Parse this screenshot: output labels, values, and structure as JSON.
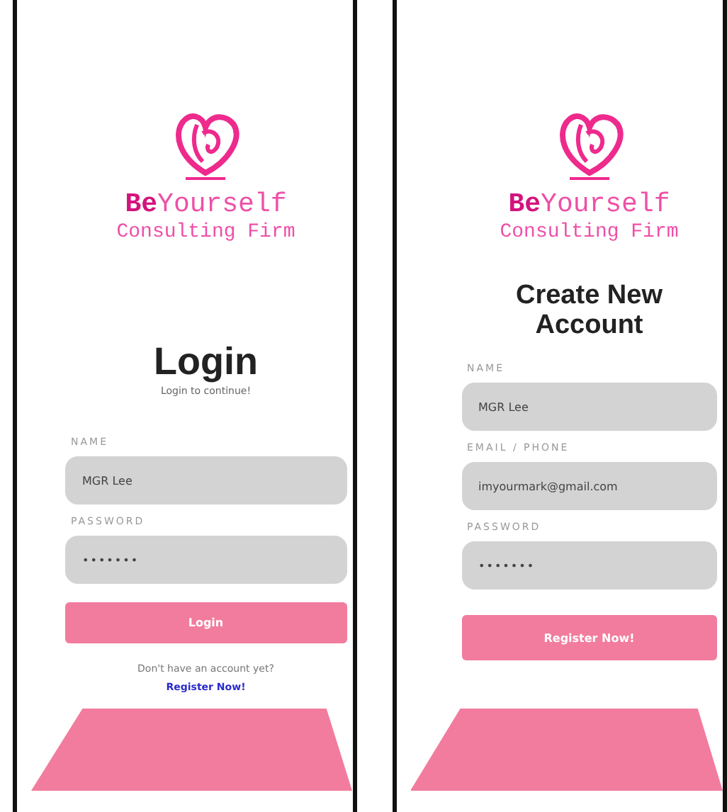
{
  "screens": [
    {
      "kind": "login",
      "brand": {
        "name": "**Be**Yourself",
        "tagline": "Consulting Firm"
      },
      "heading": "Login",
      "subtitle": "Login to continue!",
      "fields": [
        {
          "label": "NAME",
          "value": "MGR Lee",
          "kind": "text"
        },
        {
          "label": "PASSWORD",
          "value": "•••••••",
          "kind": "password"
        }
      ],
      "button": "Login",
      "prompt": "Don't have an account yet?",
      "link": "Register Now!"
    },
    {
      "kind": "register",
      "brand": {
        "name": "**Be**Yourself",
        "tagline": "Consulting Firm"
      },
      "heading": "Create New Account",
      "fields": [
        {
          "label": "NAME",
          "value": "MGR Lee",
          "kind": "text"
        },
        {
          "label": "EMAIL / PHONE",
          "value": "imyourmark@gmail.com",
          "kind": "text"
        },
        {
          "label": "PASSWORD",
          "value": "•••••••",
          "kind": "password"
        }
      ],
      "button": "Register Now!"
    }
  ]
}
